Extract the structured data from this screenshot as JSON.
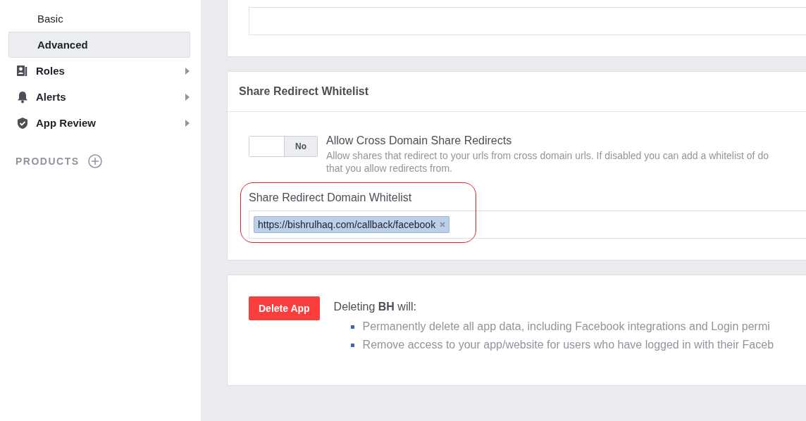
{
  "sidebar": {
    "items": [
      {
        "label": "Basic",
        "kind": "sub",
        "selected": false
      },
      {
        "label": "Advanced",
        "kind": "sub",
        "selected": true
      },
      {
        "label": "Roles",
        "kind": "section",
        "selected": false
      },
      {
        "label": "Alerts",
        "kind": "section",
        "selected": false
      },
      {
        "label": "App Review",
        "kind": "section",
        "selected": false
      }
    ],
    "products_label": "PRODUCTS"
  },
  "share_redirect": {
    "title": "Share Redirect Whitelist",
    "toggle": {
      "on": false,
      "label": "No"
    },
    "setting_title": "Allow Cross Domain Share Redirects",
    "description_lines": [
      "Allow shares that redirect to your urls from cross domain urls. If disabled you can add a whitelist of do",
      "that you allow redirects from."
    ],
    "whitelist_label": "Share Redirect Domain Whitelist",
    "tags": [
      "https://bishrulhaq.com/callback/facebook"
    ],
    "highlighted": true
  },
  "delete": {
    "button": "Delete App",
    "heading": "Deleting **BH** will:",
    "bullets": [
      "Permanently delete all app data, including Facebook integrations and Login permi",
      "Remove access to your app/website for users who have logged in with their Faceb"
    ]
  }
}
